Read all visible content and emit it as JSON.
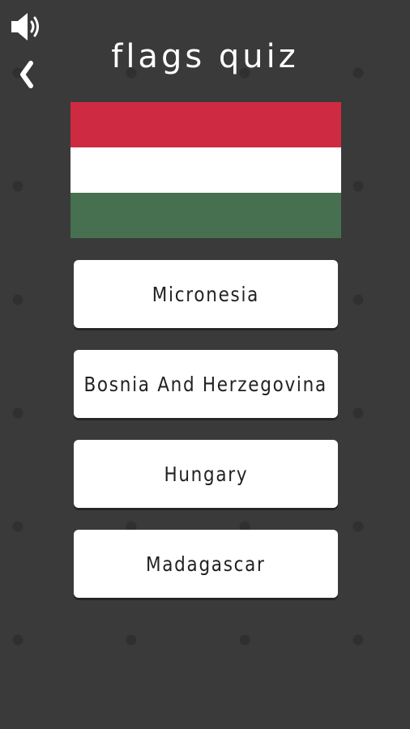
{
  "header": {
    "title": "flags quiz",
    "sound_icon": "speaker-icon",
    "back_icon": "chevron-left-icon"
  },
  "flag": {
    "country": "Hungary",
    "stripes": [
      "#ce2b42",
      "#ffffff",
      "#477050"
    ]
  },
  "answers": [
    {
      "label": "Micronesia"
    },
    {
      "label": "Bosnia And Herzegovina"
    },
    {
      "label": "Hungary"
    },
    {
      "label": "Madagascar"
    }
  ],
  "colors": {
    "background": "#3a3a3a",
    "button_bg": "#ffffff",
    "button_text": "#222222"
  }
}
